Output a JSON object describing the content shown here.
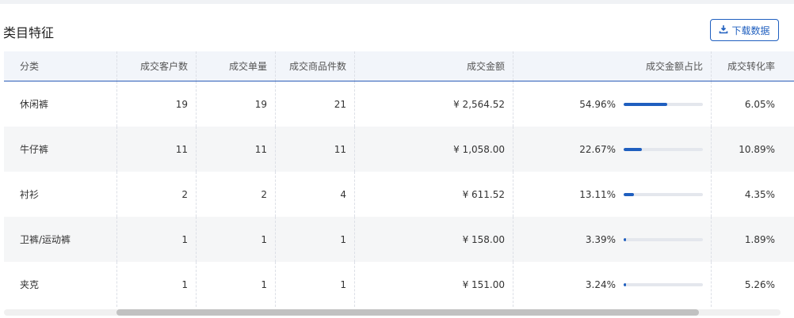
{
  "title": "类目特征",
  "download_label": "下载数据",
  "columns": [
    "分类",
    "成交客户数",
    "成交单量",
    "成交商品件数",
    "成交金额",
    "成交金额占比",
    "成交转化率"
  ],
  "rows": [
    {
      "category": "休闲裤",
      "customers": "19",
      "orders": "19",
      "items": "21",
      "amount": "¥ 2,564.52",
      "share": "54.96%",
      "share_value": 54.96,
      "conversion": "6.05%"
    },
    {
      "category": "牛仔裤",
      "customers": "11",
      "orders": "11",
      "items": "11",
      "amount": "¥ 1,058.00",
      "share": "22.67%",
      "share_value": 22.67,
      "conversion": "10.89%"
    },
    {
      "category": "衬衫",
      "customers": "2",
      "orders": "2",
      "items": "4",
      "amount": "¥ 611.52",
      "share": "13.11%",
      "share_value": 13.11,
      "conversion": "4.35%"
    },
    {
      "category": "卫裤/运动裤",
      "customers": "1",
      "orders": "1",
      "items": "1",
      "amount": "¥ 158.00",
      "share": "3.39%",
      "share_value": 3.39,
      "conversion": "1.89%"
    },
    {
      "category": "夹克",
      "customers": "1",
      "orders": "1",
      "items": "1",
      "amount": "¥ 151.00",
      "share": "3.24%",
      "share_value": 3.24,
      "conversion": "5.26%"
    }
  ],
  "colors": {
    "accent": "#1f5fbf",
    "track": "#e4e7ed"
  }
}
